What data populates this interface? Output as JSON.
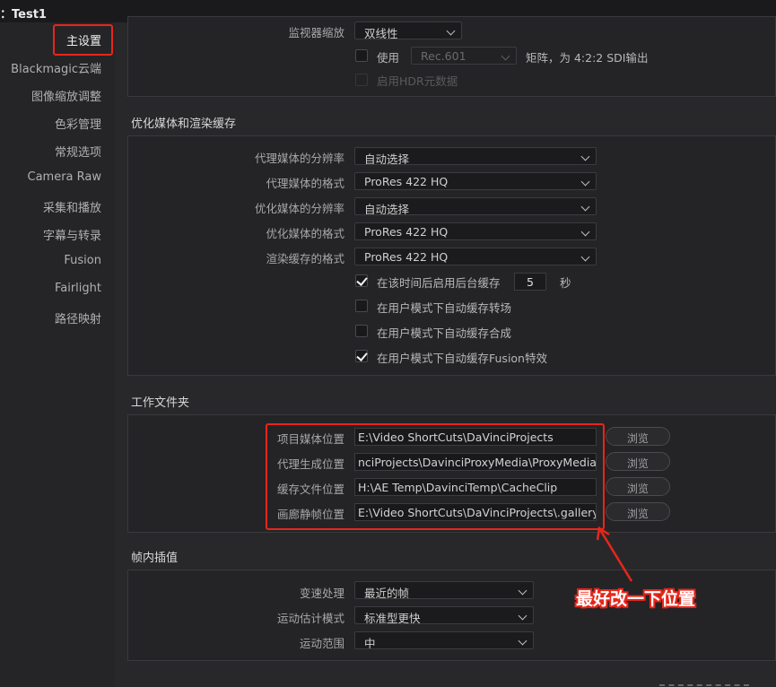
{
  "titlebar": {
    "title": "：Test1"
  },
  "sidebar": {
    "items": [
      {
        "label": "主设置",
        "active": true
      },
      {
        "label": "Blackmagic云端"
      },
      {
        "label": "图像缩放调整"
      },
      {
        "label": "色彩管理"
      },
      {
        "label": "常规选项"
      },
      {
        "label": "Camera Raw"
      },
      {
        "label": "采集和播放"
      },
      {
        "label": "字幕与转录"
      },
      {
        "label": "Fusion"
      },
      {
        "label": "Fairlight"
      },
      {
        "label": "路径映射"
      }
    ]
  },
  "monitor": {
    "scaling_label": "监视器缩放",
    "scaling_value": "双线性",
    "use_label": "使用",
    "rec_value": "Rec.601",
    "matrix_text": "矩阵，为 4:2:2 SDI输出",
    "hdr_label": "启用HDR元数据"
  },
  "optimized": {
    "title": "优化媒体和渲染缓存",
    "rows": [
      {
        "label": "代理媒体的分辨率",
        "value": "自动选择"
      },
      {
        "label": "代理媒体的格式",
        "value": "ProRes 422 HQ"
      },
      {
        "label": "优化媒体的分辨率",
        "value": "自动选择"
      },
      {
        "label": "优化媒体的格式",
        "value": "ProRes 422 HQ"
      },
      {
        "label": "渲染缓存的格式",
        "value": "ProRes 422 HQ"
      }
    ],
    "bg_cache_label": "在该时间后启用后台缓存",
    "bg_cache_value": "5",
    "bg_cache_unit": "秒",
    "checks": [
      {
        "label": "在用户模式下自动缓存转场",
        "checked": false
      },
      {
        "label": "在用户模式下自动缓存合成",
        "checked": false
      },
      {
        "label": "在用户模式下自动缓存Fusion特效",
        "checked": true
      }
    ]
  },
  "folders": {
    "title": "工作文件夹",
    "browse_label": "浏览",
    "rows": [
      {
        "label": "项目媒体位置",
        "path": "E:\\Video ShortCuts\\DaVinciProjects"
      },
      {
        "label": "代理生成位置",
        "path": "nciProjects\\DavinciProxyMedia\\ProxyMedia"
      },
      {
        "label": "缓存文件位置",
        "path": "H:\\AE Temp\\DavinciTemp\\CacheClip"
      },
      {
        "label": "画廊静帧位置",
        "path": "E:\\Video ShortCuts\\DaVinciProjects\\.gallery"
      }
    ]
  },
  "interp": {
    "title": "帧内插值",
    "rows": [
      {
        "label": "变速处理",
        "value": "最近的帧"
      },
      {
        "label": "运动估计模式",
        "value": "标准型更快"
      },
      {
        "label": "运动范围",
        "value": "中"
      }
    ]
  },
  "annotation": {
    "text": "最好改一下位置",
    "color": "#e8261a"
  }
}
